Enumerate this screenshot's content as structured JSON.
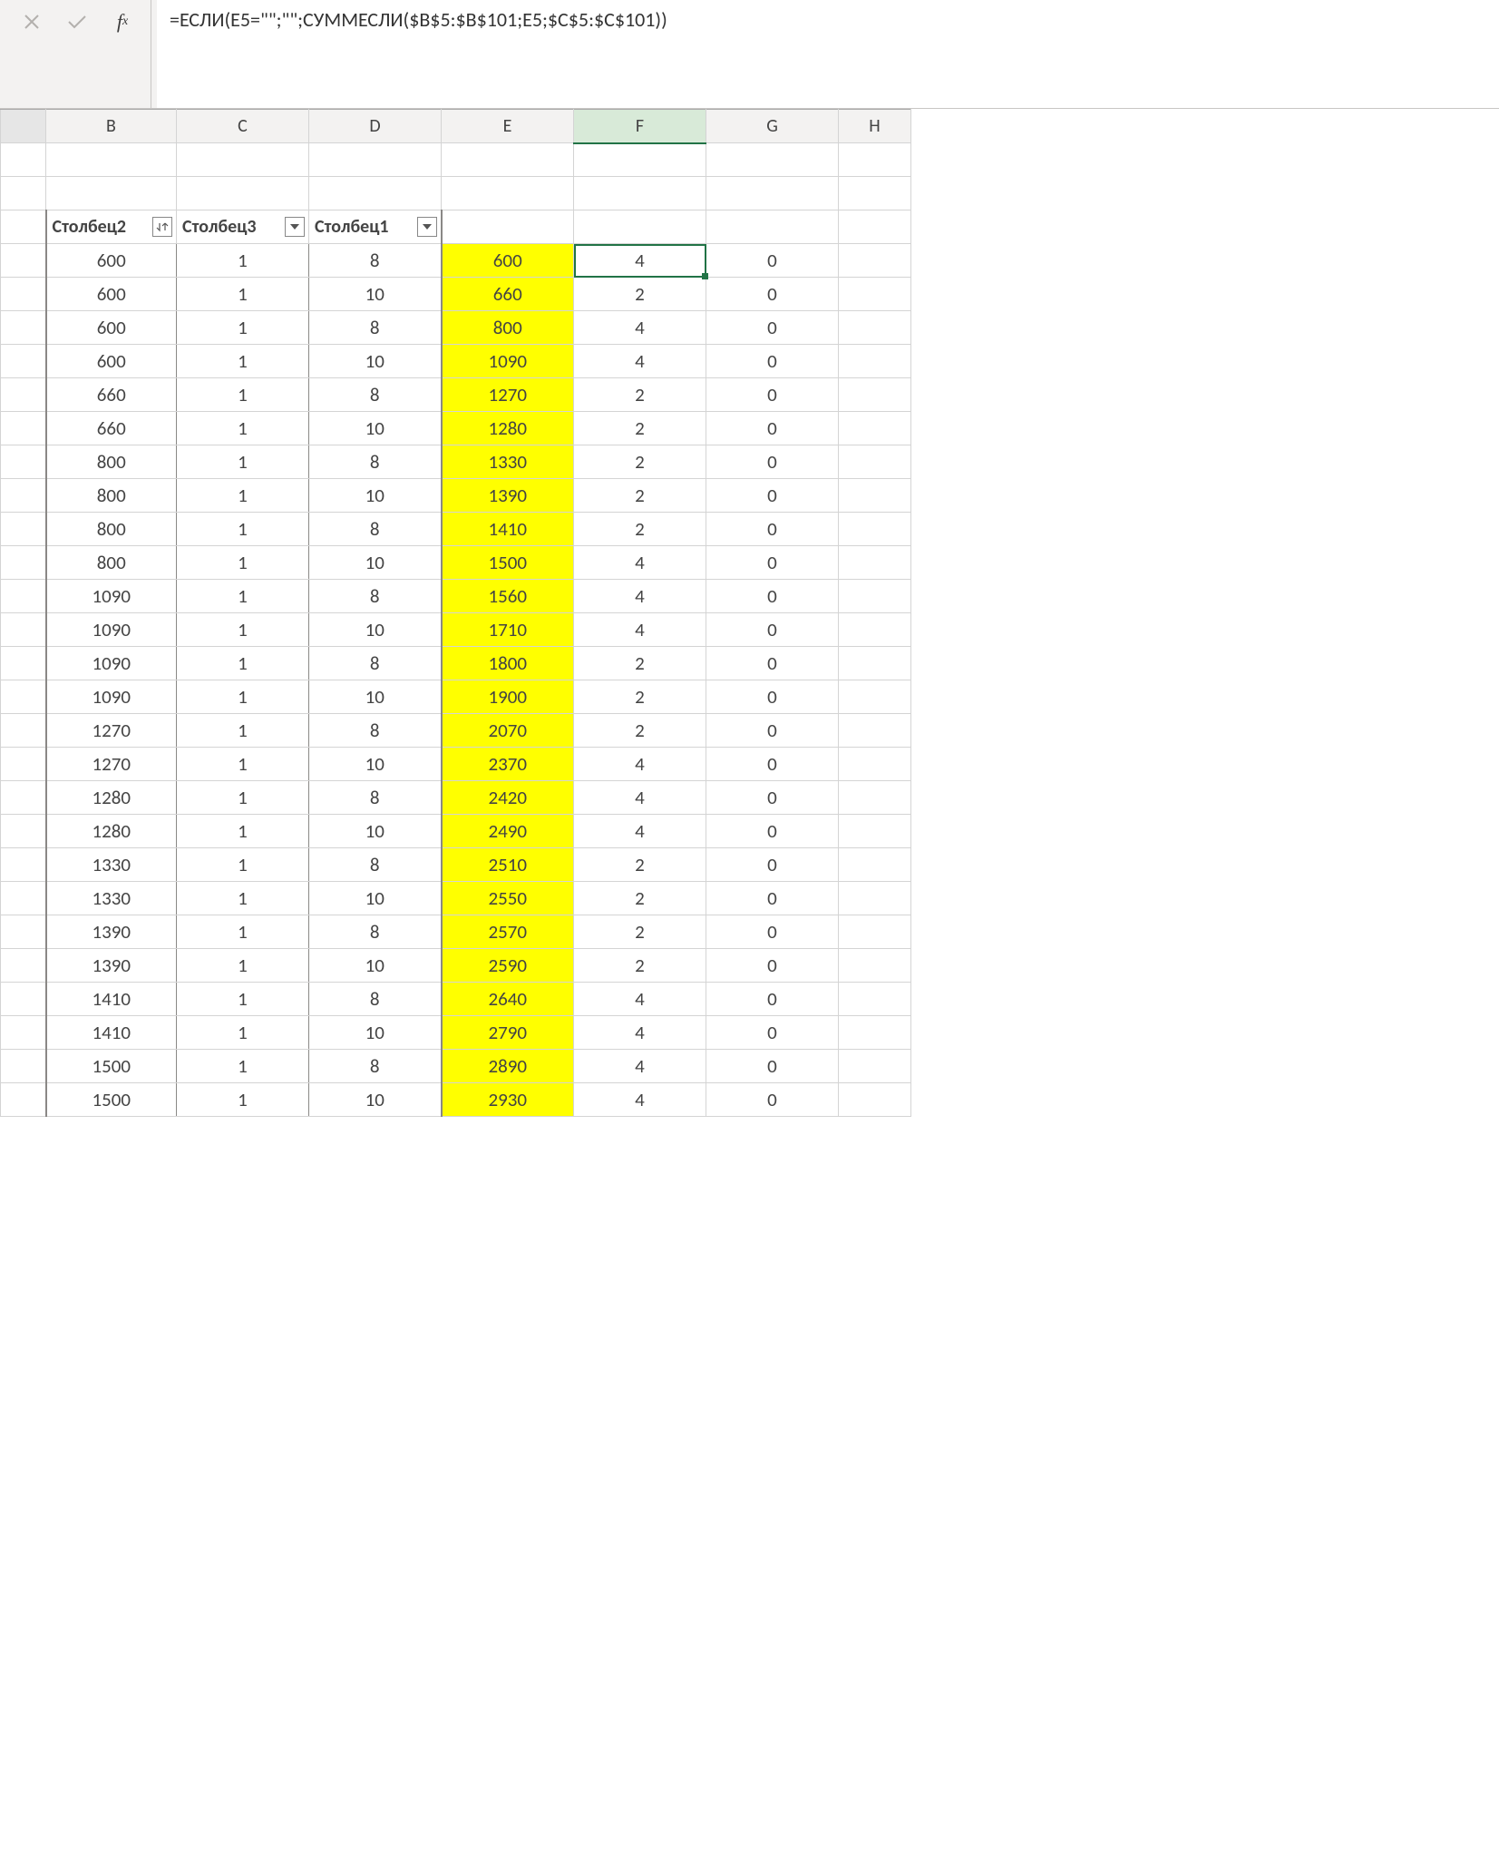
{
  "formula_bar": {
    "formula": "=ЕСЛИ(E5=\"\";\"\";СУММЕСЛИ($B$5:$B$101;E5;$C$5:$C$101))"
  },
  "columns": [
    "B",
    "C",
    "D",
    "E",
    "F",
    "G",
    "H"
  ],
  "active_column": "F",
  "table_headers": {
    "b": "Столбец2",
    "c": "Столбец3",
    "d": "Столбец1"
  },
  "rows": [
    {
      "b": 600,
      "c": 1,
      "d": 8,
      "e": 600,
      "f": 4,
      "g": 0,
      "sel": true
    },
    {
      "b": 600,
      "c": 1,
      "d": 10,
      "e": 660,
      "f": 2,
      "g": 0
    },
    {
      "b": 600,
      "c": 1,
      "d": 8,
      "e": 800,
      "f": 4,
      "g": 0
    },
    {
      "b": 600,
      "c": 1,
      "d": 10,
      "e": 1090,
      "f": 4,
      "g": 0
    },
    {
      "b": 660,
      "c": 1,
      "d": 8,
      "e": 1270,
      "f": 2,
      "g": 0
    },
    {
      "b": 660,
      "c": 1,
      "d": 10,
      "e": 1280,
      "f": 2,
      "g": 0
    },
    {
      "b": 800,
      "c": 1,
      "d": 8,
      "e": 1330,
      "f": 2,
      "g": 0
    },
    {
      "b": 800,
      "c": 1,
      "d": 10,
      "e": 1390,
      "f": 2,
      "g": 0
    },
    {
      "b": 800,
      "c": 1,
      "d": 8,
      "e": 1410,
      "f": 2,
      "g": 0
    },
    {
      "b": 800,
      "c": 1,
      "d": 10,
      "e": 1500,
      "f": 4,
      "g": 0
    },
    {
      "b": 1090,
      "c": 1,
      "d": 8,
      "e": 1560,
      "f": 4,
      "g": 0
    },
    {
      "b": 1090,
      "c": 1,
      "d": 10,
      "e": 1710,
      "f": 4,
      "g": 0
    },
    {
      "b": 1090,
      "c": 1,
      "d": 8,
      "e": 1800,
      "f": 2,
      "g": 0
    },
    {
      "b": 1090,
      "c": 1,
      "d": 10,
      "e": 1900,
      "f": 2,
      "g": 0
    },
    {
      "b": 1270,
      "c": 1,
      "d": 8,
      "e": 2070,
      "f": 2,
      "g": 0
    },
    {
      "b": 1270,
      "c": 1,
      "d": 10,
      "e": 2370,
      "f": 4,
      "g": 0
    },
    {
      "b": 1280,
      "c": 1,
      "d": 8,
      "e": 2420,
      "f": 4,
      "g": 0
    },
    {
      "b": 1280,
      "c": 1,
      "d": 10,
      "e": 2490,
      "f": 4,
      "g": 0
    },
    {
      "b": 1330,
      "c": 1,
      "d": 8,
      "e": 2510,
      "f": 2,
      "g": 0
    },
    {
      "b": 1330,
      "c": 1,
      "d": 10,
      "e": 2550,
      "f": 2,
      "g": 0
    },
    {
      "b": 1390,
      "c": 1,
      "d": 8,
      "e": 2570,
      "f": 2,
      "g": 0
    },
    {
      "b": 1390,
      "c": 1,
      "d": 10,
      "e": 2590,
      "f": 2,
      "g": 0
    },
    {
      "b": 1410,
      "c": 1,
      "d": 8,
      "e": 2640,
      "f": 4,
      "g": 0
    },
    {
      "b": 1410,
      "c": 1,
      "d": 10,
      "e": 2790,
      "f": 4,
      "g": 0
    },
    {
      "b": 1500,
      "c": 1,
      "d": 8,
      "e": 2890,
      "f": 4,
      "g": 0
    },
    {
      "b": 1500,
      "c": 1,
      "d": 10,
      "e": 2930,
      "f": 4,
      "g": 0
    }
  ]
}
